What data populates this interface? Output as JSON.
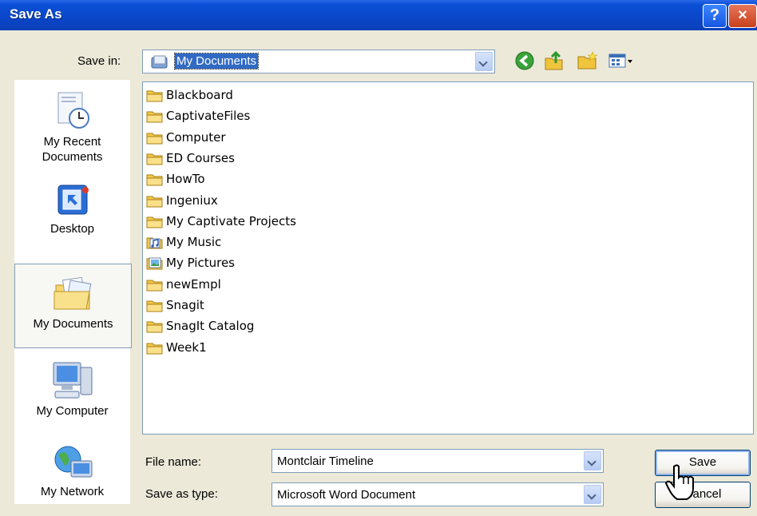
{
  "window": {
    "title": "Save As"
  },
  "title_buttons": {
    "help": "?",
    "close": "×"
  },
  "save_in": {
    "label": "Save in:",
    "value": "My Documents"
  },
  "places": [
    {
      "label": "My Recent\nDocuments",
      "icon": "recent-documents-icon"
    },
    {
      "label": "Desktop",
      "icon": "desktop-icon"
    },
    {
      "label": "My Documents",
      "icon": "my-documents-icon",
      "selected": true
    },
    {
      "label": "My Computer",
      "icon": "my-computer-icon"
    },
    {
      "label": "My Network",
      "icon": "my-network-icon"
    }
  ],
  "files": [
    {
      "name": "Blackboard",
      "icon": "folder"
    },
    {
      "name": "CaptivateFiles",
      "icon": "folder"
    },
    {
      "name": "Computer",
      "icon": "folder"
    },
    {
      "name": "ED Courses",
      "icon": "folder"
    },
    {
      "name": "HowTo",
      "icon": "folder"
    },
    {
      "name": "Ingeniux",
      "icon": "folder"
    },
    {
      "name": "My Captivate Projects",
      "icon": "folder"
    },
    {
      "name": "My Music",
      "icon": "music-folder"
    },
    {
      "name": "My Pictures",
      "icon": "pictures-folder"
    },
    {
      "name": "newEmpl",
      "icon": "folder"
    },
    {
      "name": "Snagit",
      "icon": "folder"
    },
    {
      "name": "SnagIt Catalog",
      "icon": "folder"
    },
    {
      "name": "Week1",
      "icon": "folder"
    }
  ],
  "file_name": {
    "label": "File name:",
    "value": "Montclair Timeline"
  },
  "save_as_type": {
    "label": "Save as type:",
    "value": "Microsoft Word Document"
  },
  "buttons": {
    "save": "Save",
    "cancel": "Cancel"
  },
  "colors": {
    "title_bar": "#0a46c8",
    "dialog_bg": "#ece9d8",
    "selection": "#316ac5",
    "folder": "#f4c84a"
  }
}
